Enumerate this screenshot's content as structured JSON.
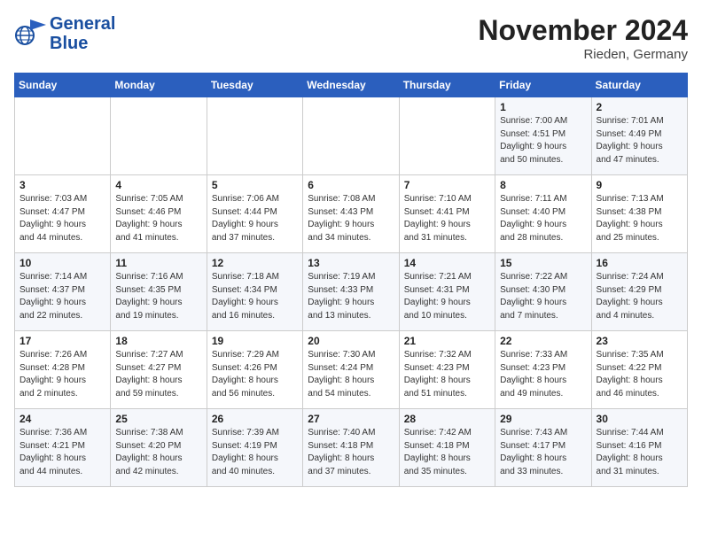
{
  "header": {
    "logo_line1": "General",
    "logo_line2": "Blue",
    "month": "November 2024",
    "location": "Rieden, Germany"
  },
  "days_of_week": [
    "Sunday",
    "Monday",
    "Tuesday",
    "Wednesday",
    "Thursday",
    "Friday",
    "Saturday"
  ],
  "weeks": [
    [
      {
        "day": "",
        "info": ""
      },
      {
        "day": "",
        "info": ""
      },
      {
        "day": "",
        "info": ""
      },
      {
        "day": "",
        "info": ""
      },
      {
        "day": "",
        "info": ""
      },
      {
        "day": "1",
        "info": "Sunrise: 7:00 AM\nSunset: 4:51 PM\nDaylight: 9 hours\nand 50 minutes."
      },
      {
        "day": "2",
        "info": "Sunrise: 7:01 AM\nSunset: 4:49 PM\nDaylight: 9 hours\nand 47 minutes."
      }
    ],
    [
      {
        "day": "3",
        "info": "Sunrise: 7:03 AM\nSunset: 4:47 PM\nDaylight: 9 hours\nand 44 minutes."
      },
      {
        "day": "4",
        "info": "Sunrise: 7:05 AM\nSunset: 4:46 PM\nDaylight: 9 hours\nand 41 minutes."
      },
      {
        "day": "5",
        "info": "Sunrise: 7:06 AM\nSunset: 4:44 PM\nDaylight: 9 hours\nand 37 minutes."
      },
      {
        "day": "6",
        "info": "Sunrise: 7:08 AM\nSunset: 4:43 PM\nDaylight: 9 hours\nand 34 minutes."
      },
      {
        "day": "7",
        "info": "Sunrise: 7:10 AM\nSunset: 4:41 PM\nDaylight: 9 hours\nand 31 minutes."
      },
      {
        "day": "8",
        "info": "Sunrise: 7:11 AM\nSunset: 4:40 PM\nDaylight: 9 hours\nand 28 minutes."
      },
      {
        "day": "9",
        "info": "Sunrise: 7:13 AM\nSunset: 4:38 PM\nDaylight: 9 hours\nand 25 minutes."
      }
    ],
    [
      {
        "day": "10",
        "info": "Sunrise: 7:14 AM\nSunset: 4:37 PM\nDaylight: 9 hours\nand 22 minutes."
      },
      {
        "day": "11",
        "info": "Sunrise: 7:16 AM\nSunset: 4:35 PM\nDaylight: 9 hours\nand 19 minutes."
      },
      {
        "day": "12",
        "info": "Sunrise: 7:18 AM\nSunset: 4:34 PM\nDaylight: 9 hours\nand 16 minutes."
      },
      {
        "day": "13",
        "info": "Sunrise: 7:19 AM\nSunset: 4:33 PM\nDaylight: 9 hours\nand 13 minutes."
      },
      {
        "day": "14",
        "info": "Sunrise: 7:21 AM\nSunset: 4:31 PM\nDaylight: 9 hours\nand 10 minutes."
      },
      {
        "day": "15",
        "info": "Sunrise: 7:22 AM\nSunset: 4:30 PM\nDaylight: 9 hours\nand 7 minutes."
      },
      {
        "day": "16",
        "info": "Sunrise: 7:24 AM\nSunset: 4:29 PM\nDaylight: 9 hours\nand 4 minutes."
      }
    ],
    [
      {
        "day": "17",
        "info": "Sunrise: 7:26 AM\nSunset: 4:28 PM\nDaylight: 9 hours\nand 2 minutes."
      },
      {
        "day": "18",
        "info": "Sunrise: 7:27 AM\nSunset: 4:27 PM\nDaylight: 8 hours\nand 59 minutes."
      },
      {
        "day": "19",
        "info": "Sunrise: 7:29 AM\nSunset: 4:26 PM\nDaylight: 8 hours\nand 56 minutes."
      },
      {
        "day": "20",
        "info": "Sunrise: 7:30 AM\nSunset: 4:24 PM\nDaylight: 8 hours\nand 54 minutes."
      },
      {
        "day": "21",
        "info": "Sunrise: 7:32 AM\nSunset: 4:23 PM\nDaylight: 8 hours\nand 51 minutes."
      },
      {
        "day": "22",
        "info": "Sunrise: 7:33 AM\nSunset: 4:23 PM\nDaylight: 8 hours\nand 49 minutes."
      },
      {
        "day": "23",
        "info": "Sunrise: 7:35 AM\nSunset: 4:22 PM\nDaylight: 8 hours\nand 46 minutes."
      }
    ],
    [
      {
        "day": "24",
        "info": "Sunrise: 7:36 AM\nSunset: 4:21 PM\nDaylight: 8 hours\nand 44 minutes."
      },
      {
        "day": "25",
        "info": "Sunrise: 7:38 AM\nSunset: 4:20 PM\nDaylight: 8 hours\nand 42 minutes."
      },
      {
        "day": "26",
        "info": "Sunrise: 7:39 AM\nSunset: 4:19 PM\nDaylight: 8 hours\nand 40 minutes."
      },
      {
        "day": "27",
        "info": "Sunrise: 7:40 AM\nSunset: 4:18 PM\nDaylight: 8 hours\nand 37 minutes."
      },
      {
        "day": "28",
        "info": "Sunrise: 7:42 AM\nSunset: 4:18 PM\nDaylight: 8 hours\nand 35 minutes."
      },
      {
        "day": "29",
        "info": "Sunrise: 7:43 AM\nSunset: 4:17 PM\nDaylight: 8 hours\nand 33 minutes."
      },
      {
        "day": "30",
        "info": "Sunrise: 7:44 AM\nSunset: 4:16 PM\nDaylight: 8 hours\nand 31 minutes."
      }
    ]
  ]
}
